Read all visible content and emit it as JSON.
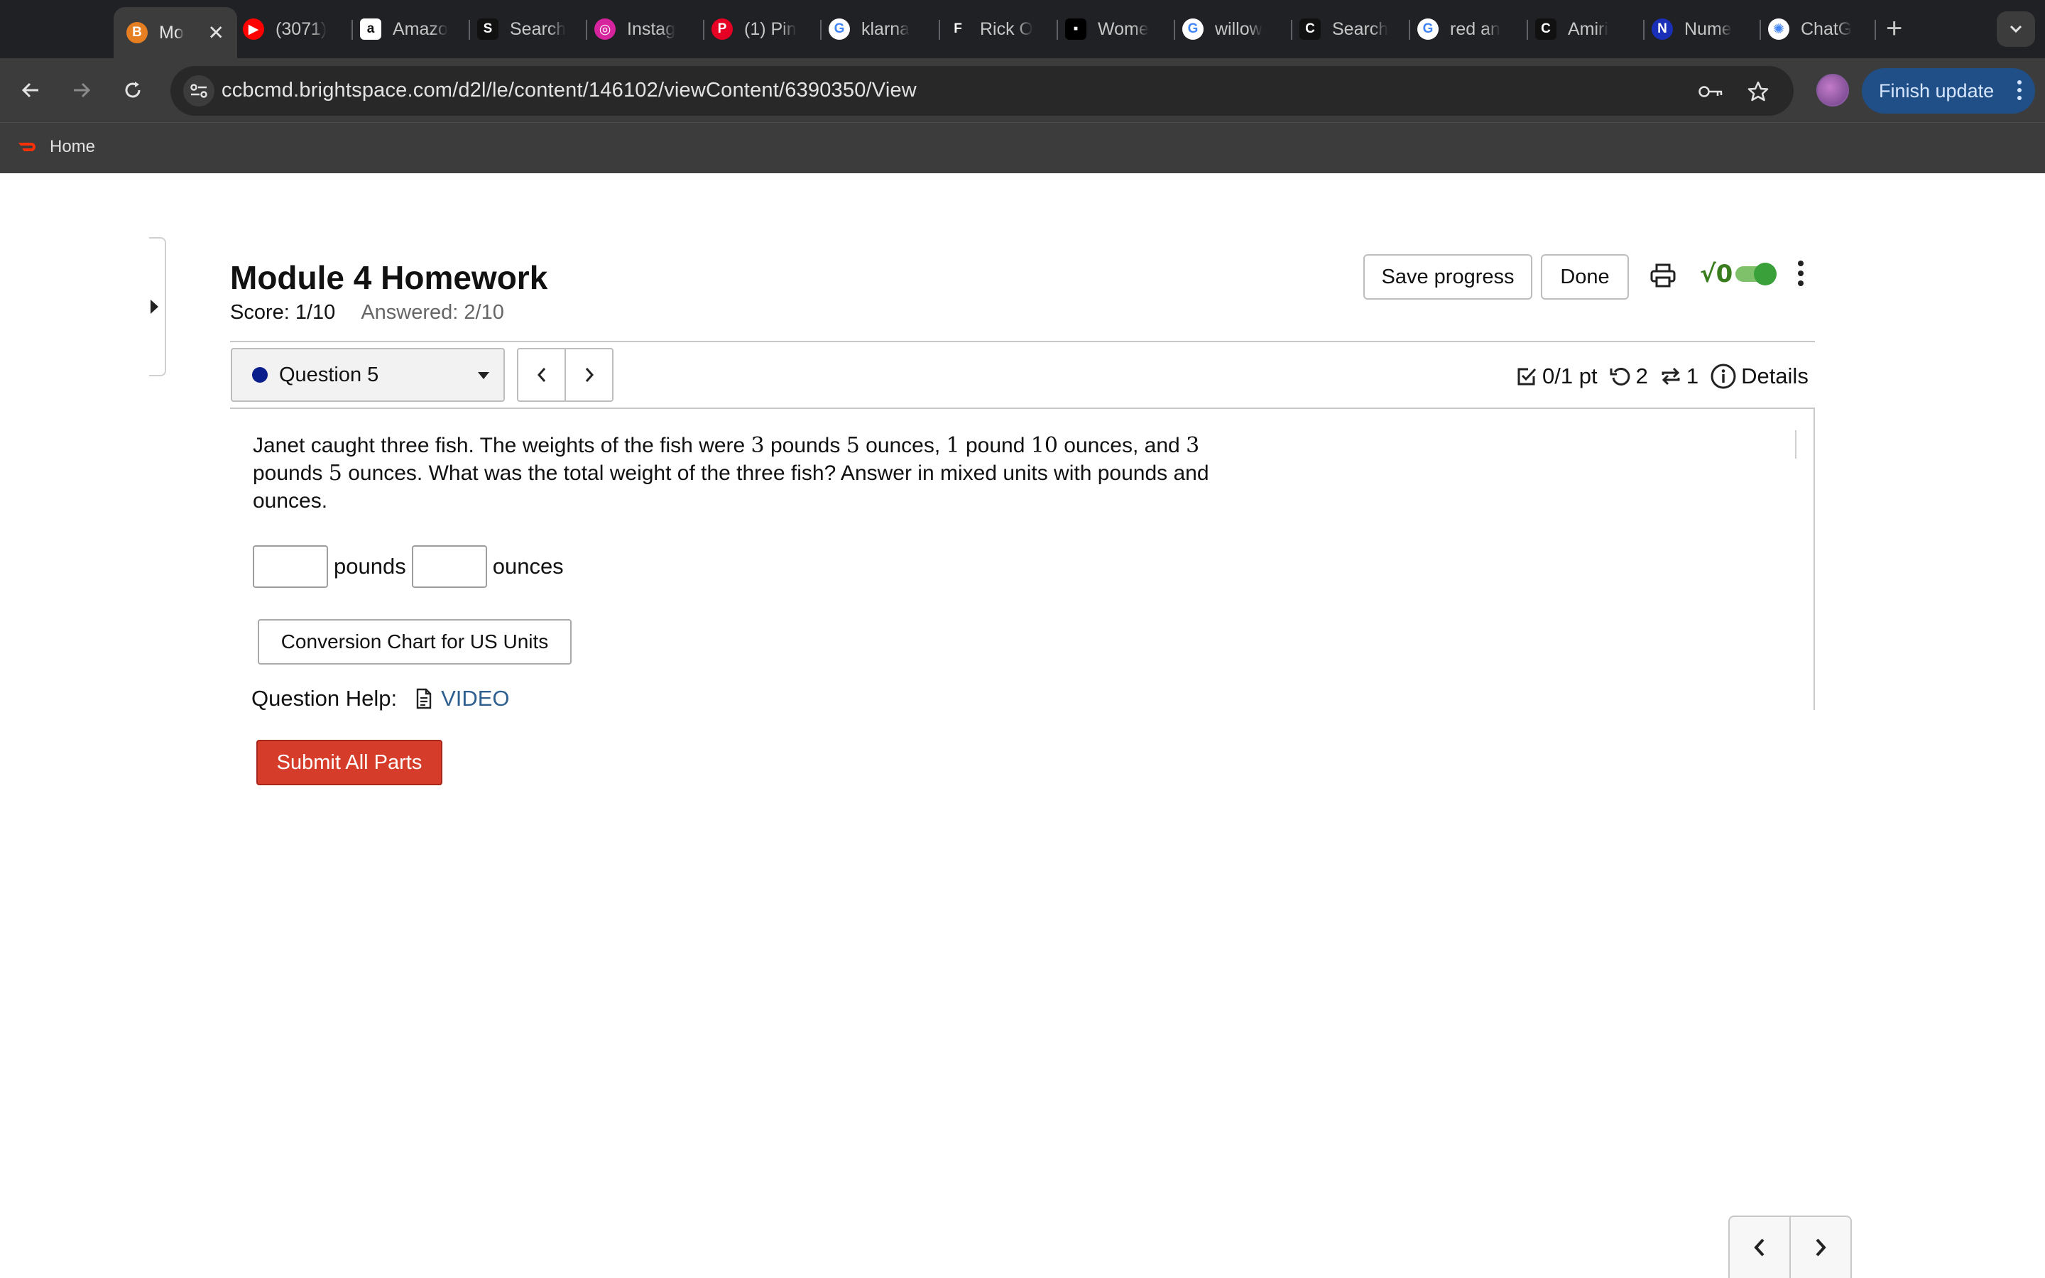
{
  "browser": {
    "tabs": [
      {
        "title": "Mo",
        "icon": "brightspace-icon",
        "color": "#e67e22",
        "glyph": "B",
        "active": true
      },
      {
        "title": "(3071)",
        "icon": "youtube-icon",
        "color": "#ff0000",
        "glyph": "▶"
      },
      {
        "title": "Amazo",
        "icon": "amazon-icon",
        "color": "#ffffff",
        "glyph": "a"
      },
      {
        "title": "Search",
        "icon": "s-icon",
        "color": "#111111",
        "glyph": "S"
      },
      {
        "title": "Instag",
        "icon": "instagram-icon",
        "color": "#d6249f",
        "glyph": "◎"
      },
      {
        "title": "(1) Pin",
        "icon": "pinterest-icon",
        "color": "#e60023",
        "glyph": "P"
      },
      {
        "title": "klarna",
        "icon": "google-icon",
        "color": "#ffffff",
        "glyph": "G"
      },
      {
        "title": "Rick O",
        "icon": "rick-owens-icon",
        "color": "#202124",
        "glyph": "F"
      },
      {
        "title": "Wome",
        "icon": "store-icon",
        "color": "#000000",
        "glyph": "▪"
      },
      {
        "title": "willow",
        "icon": "google-icon",
        "color": "#ffffff",
        "glyph": "G"
      },
      {
        "title": "Search",
        "icon": "c-icon",
        "color": "#111111",
        "glyph": "C"
      },
      {
        "title": "red an",
        "icon": "google-icon",
        "color": "#ffffff",
        "glyph": "G"
      },
      {
        "title": "Amiri",
        "icon": "c-icon",
        "color": "#111111",
        "glyph": "C"
      },
      {
        "title": "Nume",
        "icon": "n-icon",
        "color": "#1a2fb8",
        "glyph": "N"
      },
      {
        "title": "ChatG",
        "icon": "chatgpt-icon",
        "color": "#ffffff",
        "glyph": "✺"
      }
    ],
    "url": "ccbcmd.brightspace.com/d2l/le/content/146102/viewContent/6390350/View",
    "finish_update": "Finish update",
    "bookmark_home": "Home"
  },
  "homework": {
    "title": "Module 4 Homework",
    "score": "Score: 1/10",
    "answered": "Answered: 2/10",
    "save_progress": "Save progress",
    "done": "Done",
    "sqrt_label": "√0"
  },
  "question": {
    "selector_label": "Question 5",
    "points": "0/1 pt",
    "retries": "2",
    "attempts": "1",
    "details": "Details",
    "text_parts": [
      "Janet caught three fish. The weights of the fish were ",
      "3",
      " pounds ",
      "5",
      " ounces, ",
      "1",
      " pound ",
      "10",
      " ounces, and ",
      "3",
      " pounds ",
      "5",
      " ounces. What was the total weight of the three fish? Answer in mixed units with pounds and ounces."
    ],
    "pounds_value": "",
    "pounds_label": "pounds",
    "ounces_value": "",
    "ounces_label": "ounces",
    "conversion_button": "Conversion Chart for US Units",
    "help_label": "Question Help:",
    "video_label": "VIDEO",
    "submit": "Submit All Parts"
  }
}
